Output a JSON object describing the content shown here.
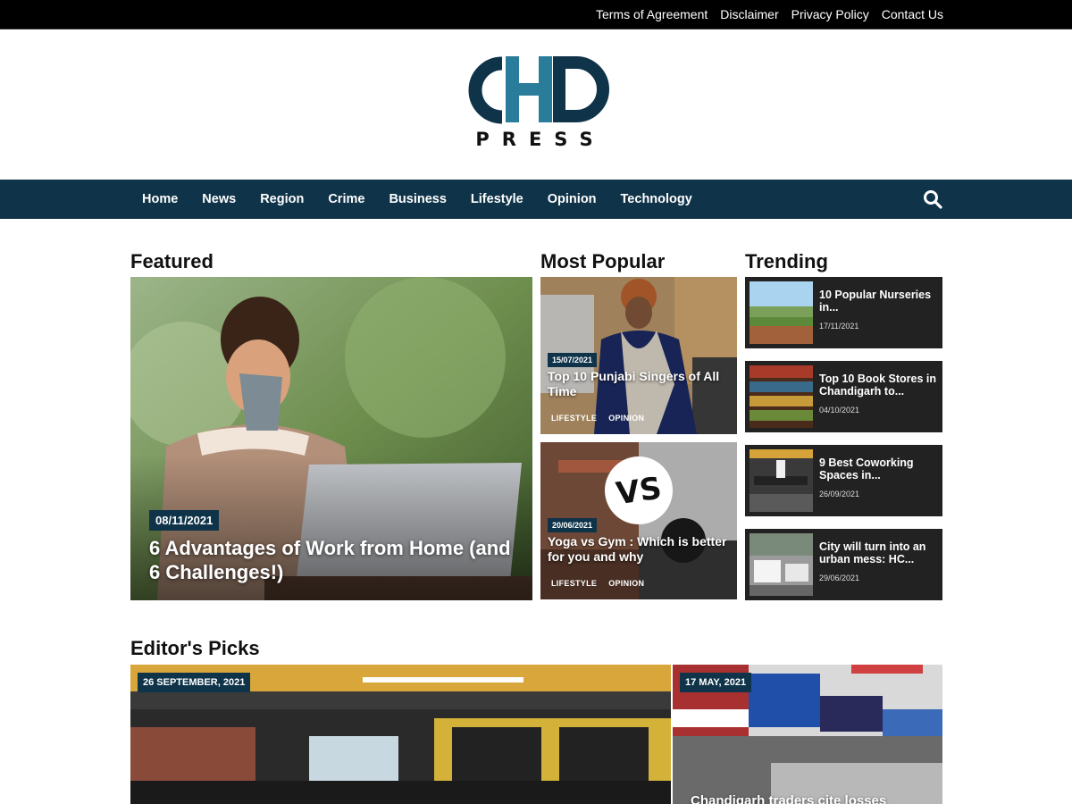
{
  "top_links": [
    "Terms of Agreement",
    "Disclaimer",
    "Privacy Policy",
    "Contact Us"
  ],
  "logo": {
    "main": "CHD",
    "sub": "PRESS"
  },
  "nav": [
    "Home",
    "News",
    "Region",
    "Crime",
    "Business",
    "Lifestyle",
    "Opinion",
    "Technology"
  ],
  "sections": {
    "featured": "Featured",
    "popular": "Most Popular",
    "trending": "Trending",
    "picks": "Editor's Picks"
  },
  "featured": {
    "date": "08/11/2021",
    "title": "6 Advantages of Work from Home (and 6 Challenges!)"
  },
  "popular": [
    {
      "date": "15/07/2021",
      "title": "Top 10 Punjabi Singers of All Time",
      "tags": [
        "LIFESTYLE",
        "OPINION"
      ]
    },
    {
      "date": "20/06/2021",
      "title": "Yoga vs Gym : Which is better for you and why",
      "tags": [
        "LIFESTYLE",
        "OPINION"
      ]
    }
  ],
  "trending": [
    {
      "title": "10 Popular Nurseries in...",
      "date": "17/11/2021"
    },
    {
      "title": "Top 10 Book Stores in Chandigarh to...",
      "date": "04/10/2021"
    },
    {
      "title": "9 Best Coworking Spaces in...",
      "date": "26/09/2021"
    },
    {
      "title": "City will turn into an urban mess: HC...",
      "date": "29/06/2021"
    }
  ],
  "picks": [
    {
      "date": "26 SEPTEMBER, 2021"
    },
    {
      "date": "17 MAY, 2021",
      "title": "Chandigarh traders cite losses"
    }
  ],
  "vs_text": "VS",
  "colors": {
    "nav": "#0f3349",
    "logo_dark": "#0f3349",
    "logo_accent": "#2a7d9a",
    "card": "#222222"
  }
}
